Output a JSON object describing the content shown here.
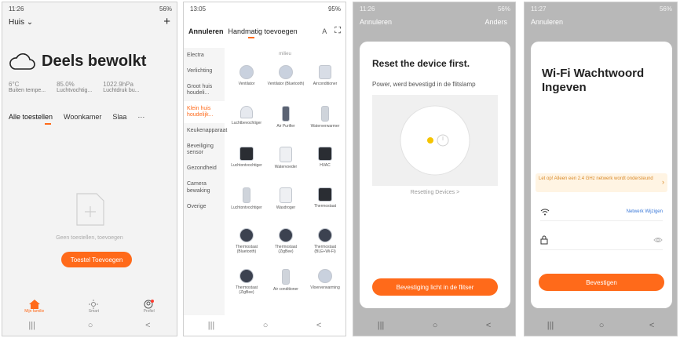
{
  "screen1": {
    "status_time": "11:26",
    "status_battery": "56%",
    "home_label": "Huis",
    "add_icon": "plus",
    "weather_icon": "cloud",
    "weather_title": "Deels bewolkt",
    "metrics": [
      {
        "value": "6°C",
        "label": "Buiten tempe..."
      },
      {
        "value": "85.0%",
        "label": "Luchtvochtig..."
      },
      {
        "value": "1022.9hPa",
        "label": "Luchtdruk bu..."
      }
    ],
    "tabs": [
      "Alle toestellen",
      "Woonkamer",
      "Slaa"
    ],
    "more": "···",
    "empty_text": "Geen toestellen, toevoegen",
    "add_button": "Toestel Toevoegen",
    "bottom_tabs": [
      {
        "label": "Mijn familie",
        "icon": "home-icon"
      },
      {
        "label": "Smart",
        "icon": "sun-icon"
      },
      {
        "label": "Profiel",
        "icon": "profile-icon"
      }
    ],
    "nav": [
      "|||",
      "○",
      "<"
    ]
  },
  "screen2": {
    "status_time": "13:05",
    "status_battery": "95%",
    "cancel": "Annuleren",
    "tab_manual": "Handmatig toevoegen",
    "tab_auto": "A",
    "categories": [
      "Electra",
      "Verlichting",
      "Groot huis houdeli...",
      "Klein huis houdelijk...",
      "Keukenapparaat",
      "Beveiliging sensor",
      "Gezondheid",
      "Camera bewaking",
      "Overige"
    ],
    "active_category": 3,
    "section": "milieu",
    "devices": [
      "Ventilator",
      "Ventilator (Bluetooth)",
      "Airconditioner",
      "Luchtbevochtiger",
      "Air Purifier",
      "Waterverwarmer",
      "Luchtontvochtiger",
      "Watervoeder",
      "HVAC",
      "Luchtontvochtiger",
      "Wasdroger",
      "Thermostaat",
      "Thermostaat (Bluetooth)",
      "Thermostaat (ZigBee)",
      "Thermostaat (BLE+Wi-Fi)",
      "Thermostaat (ZigBee)",
      "Air conditioner",
      "Vloerverwarming"
    ],
    "nav": [
      "|||",
      "○",
      "<"
    ]
  },
  "screen3": {
    "status_time": "11:26",
    "status_battery": "56%",
    "cancel": "Annuleren",
    "other": "Anders",
    "title": "Reset the device first.",
    "subtitle": "Power, werd bevestigd in de flitslamp",
    "resetting": "Resetting Devices >",
    "confirm": "Bevestiging licht in de flitser",
    "nav": [
      "|||",
      "○",
      "<"
    ]
  },
  "screen4": {
    "status_time": "11:27",
    "status_battery": "56%",
    "cancel": "Annuleren",
    "title": "Wi-Fi Wachtwoord Ingeven",
    "notice": "Let op! Alleen een 2.4 GHz netwerk wordt ondersteund",
    "network_switch": "Netwerk Wijzigen",
    "confirm": "Bevestigen",
    "nav": [
      "|||",
      "○",
      "<"
    ]
  },
  "colors": {
    "accent": "#ff6a1a",
    "link": "#3a78d8",
    "notice_bg": "#fff4e3"
  }
}
